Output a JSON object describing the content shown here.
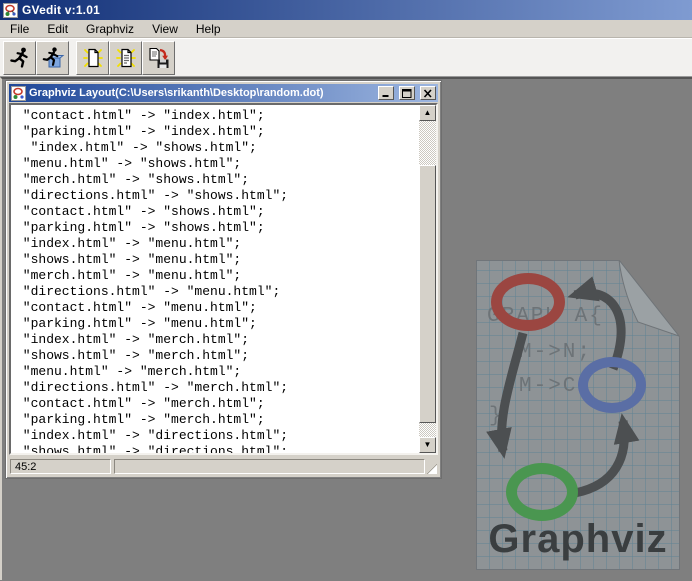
{
  "window": {
    "title": "GVedit v:1.01",
    "menu_items": [
      "File",
      "Edit",
      "Graphviz",
      "View",
      "Help"
    ],
    "toolbar_buttons": [
      "run",
      "run-with-preview",
      "new-file",
      "open-file",
      "save-file"
    ]
  },
  "child_window": {
    "title": "Graphviz Layout(C:\\Users\\srikanth\\Desktop\\random.dot)"
  },
  "editor": {
    "lines": [
      " \"contact.html\" -> \"index.html\";",
      " \"parking.html\" -> \"index.html\";",
      "  \"index.html\" -> \"shows.html\";",
      " \"menu.html\" -> \"shows.html\";",
      " \"merch.html\" -> \"shows.html\";",
      " \"directions.html\" -> \"shows.html\";",
      " \"contact.html\" -> \"shows.html\";",
      " \"parking.html\" -> \"shows.html\";",
      " \"index.html\" -> \"menu.html\";",
      " \"shows.html\" -> \"menu.html\";",
      " \"merch.html\" -> \"menu.html\";",
      " \"directions.html\" -> \"menu.html\";",
      " \"contact.html\" -> \"menu.html\";",
      " \"parking.html\" -> \"menu.html\";",
      " \"index.html\" -> \"merch.html\";",
      " \"shows.html\" -> \"merch.html\";",
      " \"menu.html\" -> \"merch.html\";",
      " \"directions.html\" -> \"merch.html\";",
      " \"contact.html\" -> \"merch.html\";",
      " \"parking.html\" -> \"merch.html\";",
      " \"index.html\" -> \"directions.html\";",
      " \"shows.html\" -> \"directions.html\";"
    ]
  },
  "status_bar": {
    "cursor_position": "45:2"
  },
  "logo": {
    "code_lines": [
      "GRAPH A{",
      "M->N;",
      "M->C;",
      "}"
    ],
    "label": "Graphviz"
  },
  "colors": {
    "titlebar_left": "#112f76",
    "titlebar_right": "#7f9bd1",
    "chrome": "#d5d1c9",
    "mdi_background": "#7f7f7f",
    "node_red": "#9b4641",
    "node_blue": "#5a6ea5",
    "node_green": "#4a9650",
    "sparkle_yellow": "#f2df00",
    "save_arrow_red": "#c42a1c"
  }
}
